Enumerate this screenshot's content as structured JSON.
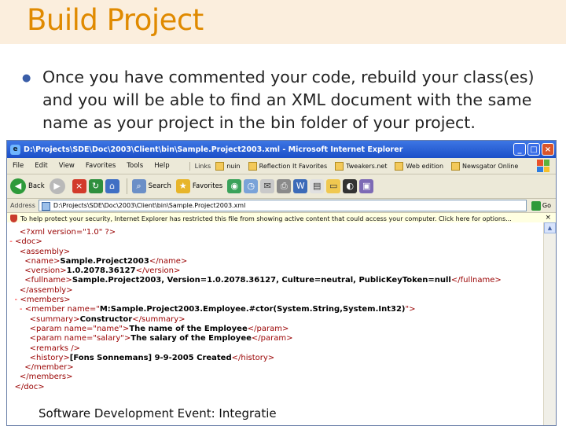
{
  "slide": {
    "title": "Build Project",
    "bullet": "Once you have commented your code, rebuild your class(es) and you will be able to find an XML document with the same name as your project in the bin folder of your project.",
    "footer": "Software Development Event: Integratie"
  },
  "browser": {
    "window_title": "D:\\Projects\\SDE\\Doc\\2003\\Client\\bin\\Sample.Project2003.xml - Microsoft Internet Explorer",
    "menu": [
      "File",
      "Edit",
      "View",
      "Favorites",
      "Tools",
      "Help"
    ],
    "links_label": "Links",
    "links": [
      "nuin",
      "Reflection It Favorites",
      "Tweakers.net",
      "Web edition",
      "Newsgator Online"
    ],
    "toolbar": {
      "back": "Back",
      "search": "Search",
      "favorites": "Favorites"
    },
    "address_label": "Address",
    "address_value": "D:\\Projects\\SDE\\Doc\\2003\\Client\\bin\\Sample.Project2003.xml",
    "go_label": "Go",
    "infobar": "To help protect your security, Internet Explorer has restricted this file from showing active content that could access your computer. Click here for options...",
    "colors": {
      "title_bar": "#1b4fc8",
      "slide_title": "#e08a00",
      "slide_band": "#fbeedd"
    }
  },
  "xml": {
    "decl_open": "<?xml version=\"1.0\" ?>",
    "doc_open": "<doc>",
    "assembly_open": "<assembly>",
    "name_open": "<name>",
    "name_value": "Sample.Project2003",
    "name_close": "</name>",
    "version_open": "<version>",
    "version_value": "1.0.2078.36127",
    "version_close": "</version>",
    "fullname_open": "<fullname>",
    "fullname_value": "Sample.Project2003, Version=1.0.2078.36127, Culture=neutral, PublicKeyToken=null",
    "fullname_close": "</fullname>",
    "assembly_close": "</assembly>",
    "members_open": "<members>",
    "member_open_pre": "<member name=\"",
    "member_name": "M:Sample.Project2003.Employee.#ctor(System.String,System.Int32)",
    "member_open_post": "\">",
    "summary_open": "<summary>",
    "summary_value": "Constructor",
    "summary_close": "</summary>",
    "param1_open": "<param name=\"name\">",
    "param1_value": "The name of the Employee",
    "param_close": "</param>",
    "param2_open": "<param name=\"salary\">",
    "param2_value": "The salary of the Employee",
    "remarks": "<remarks />",
    "history_open": "<history>",
    "history_value": "[Fons Sonnemans] 9-9-2005 Created",
    "history_close": "</history>",
    "member_close": "</member>",
    "members_close": "</members>",
    "doc_close": "</doc>",
    "minus": "-"
  }
}
